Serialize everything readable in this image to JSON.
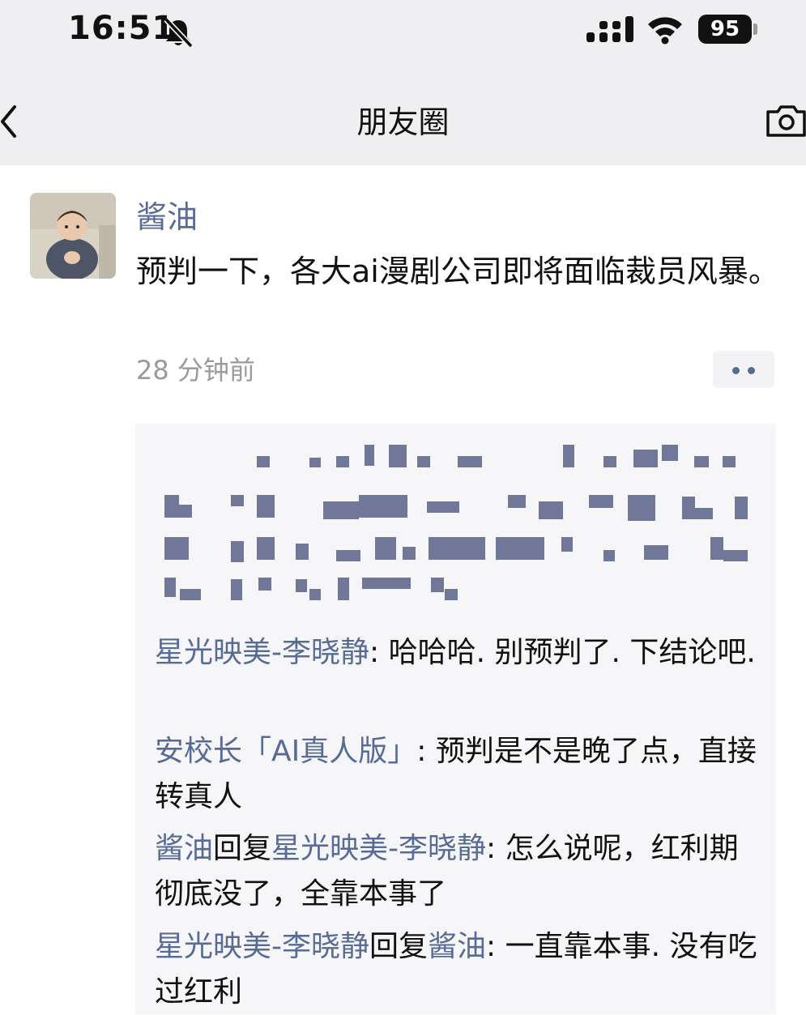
{
  "status_bar": {
    "time": "16:51",
    "battery": "95"
  },
  "nav": {
    "title": "朋友圈"
  },
  "post": {
    "author": "酱油",
    "text": "预判一下，各大ai漫剧公司即将面临裁员风暴。",
    "time": "28 分钟前"
  },
  "comments": [
    {
      "name": "星光映美-李晓静",
      "text": ": 哈哈哈. 别预判了. 下结论吧."
    },
    {
      "name": "安校长「AI真人版」",
      "text": ": 预判是不是晚了点，直接转真人"
    },
    {
      "name": "酱油",
      "reply_word": "回复",
      "target": "星光映美-李晓静",
      "text": ": 怎么说呢，红利期彻底没了，全靠本事了"
    },
    {
      "name": "星光映美-李晓静",
      "reply_word": "回复",
      "target": "酱油",
      "text": ": 一直靠本事. 没有吃过红利"
    }
  ],
  "colors": {
    "link": "#576b95",
    "top_bg": "#efeff1",
    "comment_bg": "#f6f6f8"
  }
}
